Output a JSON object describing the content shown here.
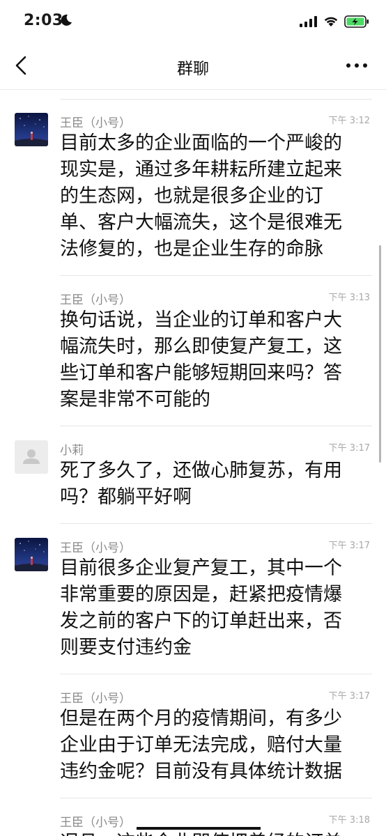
{
  "status_bar": {
    "time": "2:03",
    "icons": [
      "moon-icon",
      "signal-icon",
      "wifi-icon",
      "battery-charging-icon"
    ]
  },
  "nav": {
    "title": "群聊",
    "back_icon": "chevron-left-icon",
    "more_icon": "more-dots-icon"
  },
  "messages": [
    {
      "sender": "王臣（小号）",
      "time": "下午 3:12",
      "avatar": "night-sky-avatar",
      "show_avatar": true,
      "text": "目前太多的企业面临的一个严峻的现实是，通过多年耕耘所建立起来的生态网，也就是很多企业的订单、客户大幅流失，这个是很难无法修复的，也是企业生存的命脉"
    },
    {
      "sender": "王臣（小号）",
      "time": "下午 3:13",
      "avatar": "",
      "show_avatar": false,
      "text": "换句话说，当企业的订单和客户大幅流失时，那么即使复产复工，这些订单和客户能够短期回来吗？答案是非常不可能的"
    },
    {
      "sender": "小莉",
      "time": "下午 3:17",
      "avatar": "default-user-avatar",
      "show_avatar": true,
      "text": "死了多久了，还做心肺复苏，有用吗？都躺平好啊"
    },
    {
      "sender": "王臣（小号）",
      "time": "下午 3:17",
      "avatar": "night-sky-avatar",
      "show_avatar": true,
      "text": "目前很多企业复产复工，其中一个非常重要的原因是，赶紧把疫情爆发之前的客户下的订单赶出来，否则要支付违约金"
    },
    {
      "sender": "王臣（小号）",
      "time": "下午 3:17",
      "avatar": "",
      "show_avatar": false,
      "text": "但是在两个月的疫情期间，有多少企业由于订单无法完成，赔付大量违约金呢？目前没有具体统计数据"
    },
    {
      "sender": "王臣（小号）",
      "time": "下午 3:18",
      "avatar": "",
      "show_avatar": false,
      "text": "况且，这些企业即使把曾经的订单"
    }
  ],
  "colors": {
    "text": "#111111",
    "meta": "#8a8a8a",
    "divider": "#e6e6e6",
    "battery": "#4cd964"
  }
}
